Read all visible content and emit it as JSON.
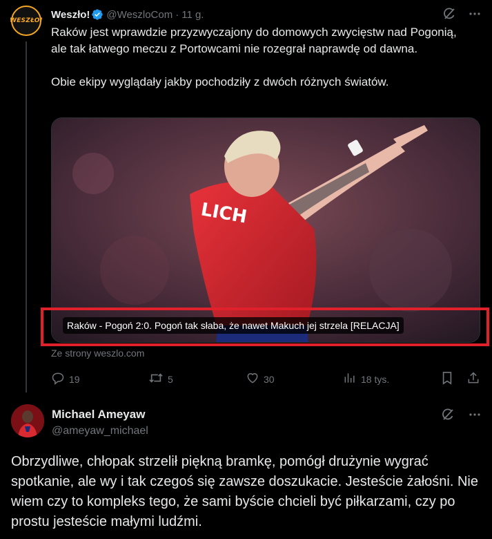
{
  "tweet1": {
    "author_name": "Weszło!",
    "author_handle": "@WeszloCom",
    "separator": "·",
    "time": "11 g.",
    "avatar_text": "WESZŁO!",
    "text_p1": "Raków jest wprawdzie przyzwyczajony do domowych zwycięstw nad Pogonią, ale tak łatwego meczu z Portowcami nie rozegrał naprawdę od dawna.",
    "text_p2": "Obie ekipy wyglądały jakby pochodziły z dwóch różnych światów.",
    "card_caption": "Raków - Pogoń 2:0. Pogoń tak słaba, że nawet Makuch jej strzela [RELACJA]",
    "card_source": "Ze strony weszlo.com",
    "replies": "19",
    "reposts": "5",
    "likes": "30",
    "views": "18 tys."
  },
  "tweet2": {
    "author_name": "Michael Ameyaw",
    "author_handle": "@ameyaw_michael",
    "text": "Obrzydliwe, chłopak strzelił piękną bramkę, pomógł drużynie wygrać spotkanie, ale wy i tak czegoś się zawsze doszukacie. Jesteście żałośni. Nie wiem czy to kompleks tego, że sami byście chcieli być piłkarzami, czy po prostu jesteście małymi ludźmi."
  },
  "colors": {
    "background": "#000000",
    "text": "#e7e9ea",
    "muted": "#71767b",
    "verified": "#1d9bf0",
    "highlight": "#e0202a"
  },
  "icons": [
    "verified-badge-icon",
    "grok-icon",
    "more-icon",
    "reply-icon",
    "repost-icon",
    "like-icon",
    "views-icon",
    "bookmark-icon",
    "share-icon"
  ]
}
